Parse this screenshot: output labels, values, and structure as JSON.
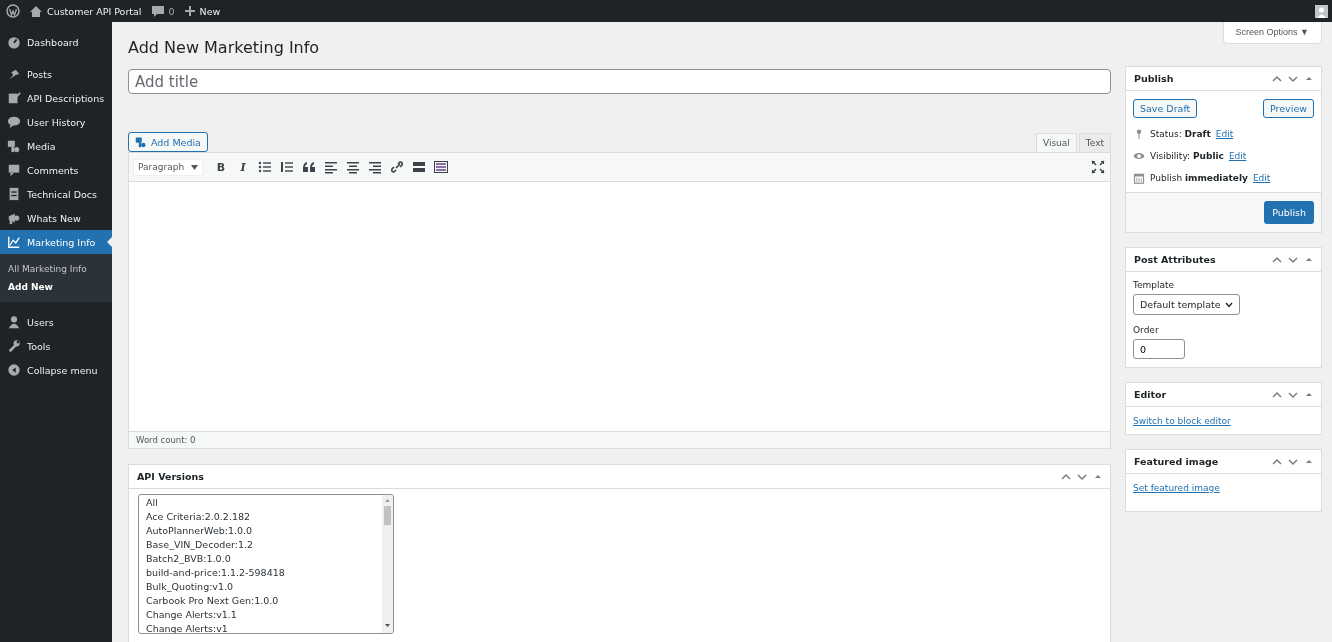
{
  "admin_bar": {
    "site": "Customer API Portal",
    "comments": "0",
    "new": "New"
  },
  "sidebar": {
    "items": [
      {
        "label": "Dashboard",
        "selected": false
      },
      {
        "label": "Posts",
        "selected": false
      },
      {
        "label": "API Descriptions",
        "selected": false
      },
      {
        "label": "User History",
        "selected": false
      },
      {
        "label": "Media",
        "selected": false
      },
      {
        "label": "Comments",
        "selected": false
      },
      {
        "label": "Technical Docs",
        "selected": false
      },
      {
        "label": "Whats New",
        "selected": false
      },
      {
        "label": "Marketing Info",
        "selected": true,
        "children": [
          {
            "label": "All Marketing Info",
            "selected": false
          },
          {
            "label": "Add New",
            "selected": true
          }
        ]
      },
      {
        "label": "Users",
        "selected": false
      },
      {
        "label": "Tools",
        "selected": false
      },
      {
        "label": "Collapse menu",
        "selected": false
      }
    ]
  },
  "screen_options": "Screen Options ▼",
  "page_title": "Add New Marketing Info",
  "title_field": {
    "placeholder": "Add title"
  },
  "add_media": "Add Media",
  "editor_tabs": [
    {
      "label": "Visual",
      "selected": true
    },
    {
      "label": "Text",
      "selected": false
    }
  ],
  "format_select": "Paragraph",
  "toolbar": [
    {
      "kind": "text",
      "label": "B"
    },
    {
      "kind": "text",
      "label": "I"
    },
    {
      "kind": "bullets"
    },
    {
      "kind": "numbers"
    },
    {
      "kind": "quote"
    },
    {
      "kind": "align-left"
    },
    {
      "kind": "align-center"
    },
    {
      "kind": "align-right"
    },
    {
      "kind": "link"
    },
    {
      "kind": "more"
    },
    {
      "kind": "kitchen"
    }
  ],
  "word_count": "Word count: 0",
  "api_versions": {
    "title": "API Versions",
    "items": [
      "All",
      "Ace Criteria:2.0.2.182",
      "AutoPlannerWeb:1.0.0",
      "Base_VIN_Decoder:1.2",
      "Batch2_BVB:1.0.0",
      "build-and-price:1.1.2-598418",
      "Bulk_Quoting:v1.0",
      "Carbook Pro Next Gen:1.0.0",
      "Change Alerts:v1.1",
      "Change Alerts:v1"
    ]
  },
  "publish": {
    "title": "Publish",
    "save_draft": "Save Draft",
    "preview": "Preview",
    "rows": [
      {
        "label": "Status:",
        "value": "Draft",
        "link": "Edit"
      },
      {
        "label": "Visibility:",
        "value": "Public",
        "link": "Edit"
      },
      {
        "label": "Publish",
        "value": "immediately",
        "link": "Edit"
      }
    ],
    "button": "Publish"
  },
  "post_attributes": {
    "title": "Post Attributes",
    "template_label": "Template",
    "template_value": "Default template",
    "order_label": "Order",
    "order_value": "0"
  },
  "editor_box": {
    "title": "Editor",
    "link": "Switch to block editor"
  },
  "featured_image": {
    "title": "Featured image",
    "link": "Set featured image"
  }
}
